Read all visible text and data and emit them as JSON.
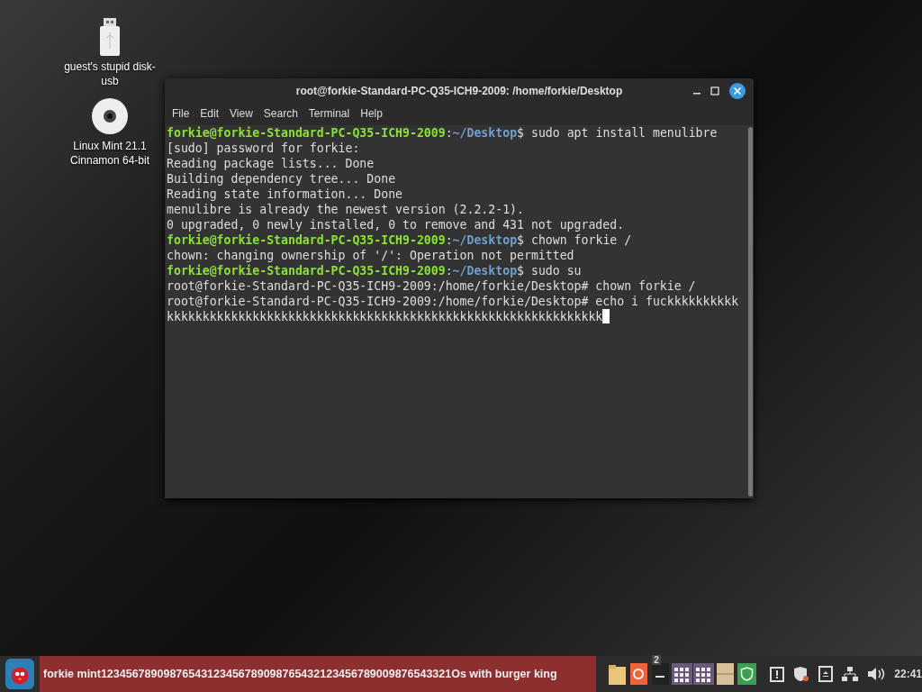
{
  "desktop_icons": [
    {
      "kind": "usb",
      "label": "guest's stupid disk-usb"
    },
    {
      "kind": "disc",
      "label": "Linux Mint 21.1 Cinnamon 64-bit"
    }
  ],
  "window": {
    "title": "root@forkie-Standard-PC-Q35-ICH9-2009: /home/forkie/Desktop",
    "menu": [
      "File",
      "Edit",
      "View",
      "Search",
      "Terminal",
      "Help"
    ],
    "lines": [
      {
        "kind": "prompt",
        "user": "forkie@forkie-Standard-PC-Q35-ICH9-2009",
        "separator": ":",
        "path": "~/Desktop",
        "sigil": "$",
        "command": "sudo apt install menulibre"
      },
      {
        "kind": "output",
        "text": "[sudo] password for forkie:"
      },
      {
        "kind": "output",
        "text": "Reading package lists... Done"
      },
      {
        "kind": "output",
        "text": "Building dependency tree... Done"
      },
      {
        "kind": "output",
        "text": "Reading state information... Done"
      },
      {
        "kind": "output",
        "text": "menulibre is already the newest version (2.2.2-1)."
      },
      {
        "kind": "output",
        "text": "0 upgraded, 0 newly installed, 0 to remove and 431 not upgraded."
      },
      {
        "kind": "prompt",
        "user": "forkie@forkie-Standard-PC-Q35-ICH9-2009",
        "separator": ":",
        "path": "~/Desktop",
        "sigil": "$",
        "command": "chown forkie /"
      },
      {
        "kind": "output",
        "text": "chown: changing ownership of '/': Operation not permitted"
      },
      {
        "kind": "prompt",
        "user": "forkie@forkie-Standard-PC-Q35-ICH9-2009",
        "separator": ":",
        "path": "~/Desktop",
        "sigil": "$",
        "command": "sudo su"
      },
      {
        "kind": "output",
        "text": "root@forkie-Standard-PC-Q35-ICH9-2009:/home/forkie/Desktop# chown forkie /"
      },
      {
        "kind": "output",
        "text": "root@forkie-Standard-PC-Q35-ICH9-2009:/home/forkie/Desktop# echo i fuckkkkkkkkkk"
      },
      {
        "kind": "cursor",
        "text": "kkkkkkkkkkkkkkkkkkkkkkkkkkkkkkkkkkkkkkkkkkkkkkkkkkkkkkkkkkkkk"
      }
    ]
  },
  "taskbar": {
    "window_button": "forkie mint12345678909876543123456789098765432123456789009876543321Os with burger king",
    "apps": [
      {
        "kind": "folder"
      },
      {
        "kind": "orange"
      },
      {
        "kind": "dark",
        "badge": "2"
      },
      {
        "kind": "grid"
      },
      {
        "kind": "grid"
      },
      {
        "kind": "box"
      },
      {
        "kind": "shield"
      }
    ],
    "tray": [
      {
        "kind": "clipboard"
      },
      {
        "kind": "shield"
      },
      {
        "kind": "eject"
      },
      {
        "kind": "network"
      },
      {
        "kind": "volume"
      }
    ],
    "clock": "22:41"
  }
}
